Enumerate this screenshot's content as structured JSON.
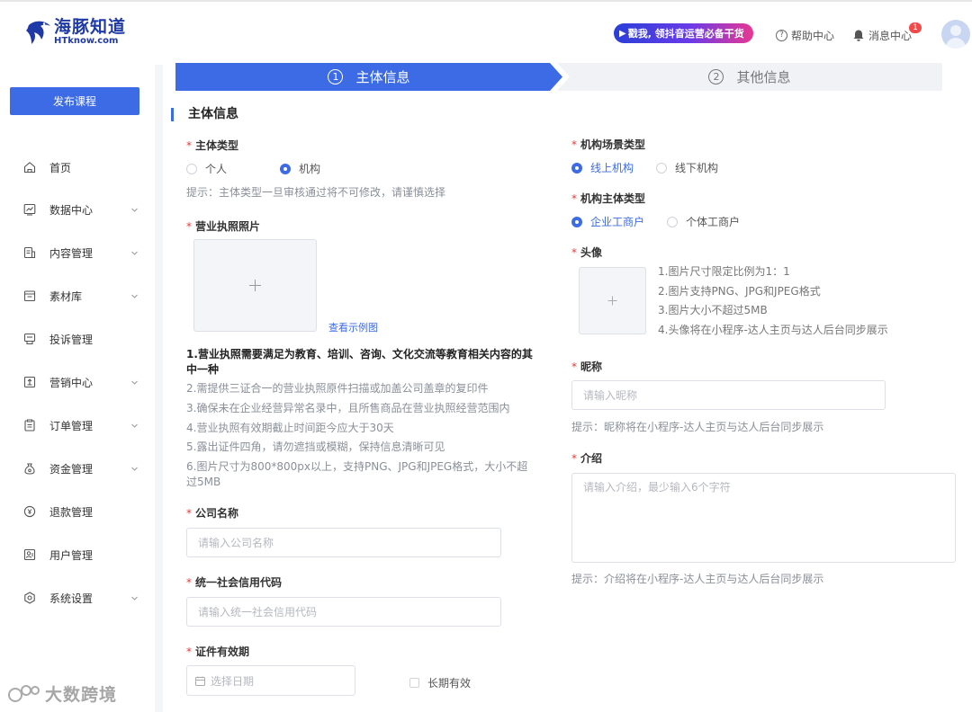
{
  "header": {
    "logo_cn": "海豚知道",
    "logo_en": "HTknow.com",
    "promo": "戳我, 领抖音运营必备干货",
    "help": "帮助中心",
    "messages": "消息中心",
    "message_badge": "1"
  },
  "sidebar": {
    "publish_button": "发布课程",
    "items": [
      {
        "label": "首页",
        "icon": "home-icon",
        "has_submenu": false
      },
      {
        "label": "数据中心",
        "icon": "chart-icon",
        "has_submenu": true
      },
      {
        "label": "内容管理",
        "icon": "content-icon",
        "has_submenu": true
      },
      {
        "label": "素材库",
        "icon": "folder-icon",
        "has_submenu": true
      },
      {
        "label": "投诉管理",
        "icon": "complaint-icon",
        "has_submenu": false
      },
      {
        "label": "营销中心",
        "icon": "marketing-icon",
        "has_submenu": true
      },
      {
        "label": "订单管理",
        "icon": "order-icon",
        "has_submenu": true
      },
      {
        "label": "资金管理",
        "icon": "money-bag-icon",
        "has_submenu": true
      },
      {
        "label": "退款管理",
        "icon": "refund-icon",
        "has_submenu": false
      },
      {
        "label": "用户管理",
        "icon": "user-icon",
        "has_submenu": false
      },
      {
        "label": "系统设置",
        "icon": "settings-icon",
        "has_submenu": true
      }
    ]
  },
  "steps": [
    {
      "num": "1",
      "label": "主体信息",
      "active": true
    },
    {
      "num": "2",
      "label": "其他信息",
      "active": false
    }
  ],
  "form": {
    "section_title": "主体信息",
    "subject_type": {
      "label": "主体类型",
      "options": [
        "个人",
        "机构"
      ],
      "selected": "机构"
    },
    "subject_hint": "提示：主体类型一旦审核通过将不可修改，请谨慎选择",
    "license": {
      "label": "营业执照照片",
      "example_link": "查看示例图"
    },
    "license_rules": [
      "1.营业执照需要满足为教育、培训、咨询、文化交流等教育相关内容的其中一种",
      "2.需提供三证合一的营业执照原件扫描或加盖公司盖章的复印件",
      "3.确保未在企业经营异常名录中，且所售商品在营业执照经营范围内",
      "4.营业执照有效期截止时间距今应大于30天",
      "5.露出证件四角，请勿遮挡或模糊，保持信息清晰可见",
      "6.图片尺寸为800*800px以上，支持PNG、JPG和JPEG格式，大小不超过5MB"
    ],
    "company_name": {
      "label": "公司名称",
      "placeholder": "请输入公司名称"
    },
    "credit_code": {
      "label": "统一社会信用代码",
      "placeholder": "请输入统一社会信用代码"
    },
    "validity": {
      "label": "证件有效期",
      "placeholder": "选择日期",
      "long_term": "长期有效"
    },
    "scene_type": {
      "label": "机构场景类型",
      "options": [
        "线上机构",
        "线下机构"
      ],
      "selected": "线上机构"
    },
    "org_subject_type": {
      "label": "机构主体类型",
      "options": [
        "企业工商户",
        "个体工商户"
      ],
      "selected": "企业工商户"
    },
    "avatar": {
      "label": "头像",
      "tips": [
        "1.图片尺寸限定比例为1：1",
        "2.图片支持PNG、JPG和JPEG格式",
        "3.图片大小不超过5MB",
        "4.头像将在小程序-达人主页与达人后台同步展示"
      ]
    },
    "nickname": {
      "label": "昵称",
      "placeholder": "请输入昵称",
      "hint": "提示：昵称将在小程序-达人主页与达人后台同步展示"
    },
    "intro": {
      "label": "介绍",
      "placeholder": "请输入介绍，最少输入6个字符",
      "hint": "提示：介绍将在小程序-达人主页与达人后台同步展示"
    }
  },
  "watermark": "大数跨境",
  "colors": {
    "primary": "#3d6be5",
    "required": "#e23c3c",
    "badge": "#f04a4a"
  }
}
